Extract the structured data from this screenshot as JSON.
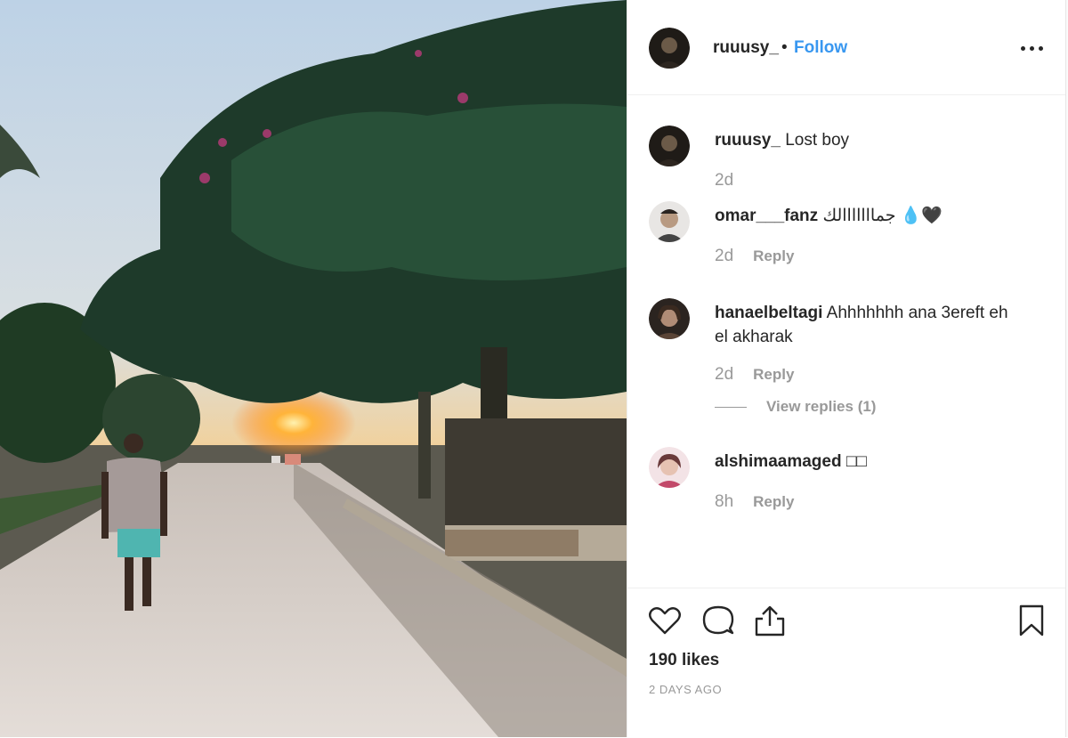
{
  "post": {
    "username": "ruuusy_",
    "separator": "•",
    "follow_label": "Follow",
    "more_icon": "more-options-icon"
  },
  "comments": [
    {
      "username": "ruuusy_",
      "text": "Lost boy",
      "time": "2d",
      "reply": ""
    },
    {
      "username": "omar___fanz",
      "text": "جمااااااالك 💧🖤",
      "time": "2d",
      "reply": "Reply"
    },
    {
      "username": "hanaelbeltagi",
      "text": "Ahhhhhhh ana 3ereft eh el akharak",
      "time": "2d",
      "reply": "Reply"
    },
    {
      "username": "alshimaamaged",
      "text": "□□",
      "time": "8h",
      "reply": "Reply"
    }
  ],
  "view_replies": "View replies (1)",
  "actions": {
    "like_icon": "heart-icon",
    "comment_icon": "comment-icon",
    "share_icon": "share-icon",
    "save_icon": "bookmark-icon"
  },
  "likes": "190 likes",
  "timestamp": "2 DAYS AGO",
  "colors": {
    "follow": "#3897f0",
    "text": "#262626",
    "muted": "#999999"
  }
}
